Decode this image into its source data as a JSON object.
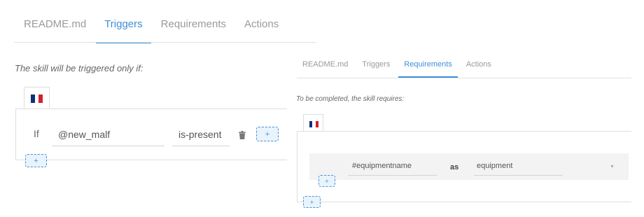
{
  "flag_colors": {
    "left": "#0e2f7a",
    "middle": "#ffffff",
    "right": "#d2202e"
  },
  "accent_color": "#3d8fd9",
  "triggers_panel": {
    "tabs": [
      {
        "label": "README.md",
        "active": false
      },
      {
        "label": "Triggers",
        "active": true
      },
      {
        "label": "Requirements",
        "active": false
      },
      {
        "label": "Actions",
        "active": false
      }
    ],
    "description": "The skill will be triggered only if:",
    "language_icon": "french-flag-icon",
    "condition_row": {
      "if_label": "If",
      "trigger_value": "@new_malf",
      "condition_value": "is-present",
      "delete_icon": "trash-icon",
      "add_label": "+"
    },
    "add_label": "+"
  },
  "requirements_panel": {
    "tabs": [
      {
        "label": "README.md",
        "active": false
      },
      {
        "label": "Triggers",
        "active": false
      },
      {
        "label": "Requirements",
        "active": true
      },
      {
        "label": "Actions",
        "active": false
      }
    ],
    "description": "To be completed, the skill requires:",
    "language_icon": "french-flag-icon",
    "requirement_row": {
      "entity_value": "#equipmentname",
      "as_label": "as",
      "alias_value": "equipment",
      "dropdown_icon": "caret-down-icon",
      "dropdown_glyph": "▼",
      "add_label": "+"
    },
    "add_label": "+"
  }
}
